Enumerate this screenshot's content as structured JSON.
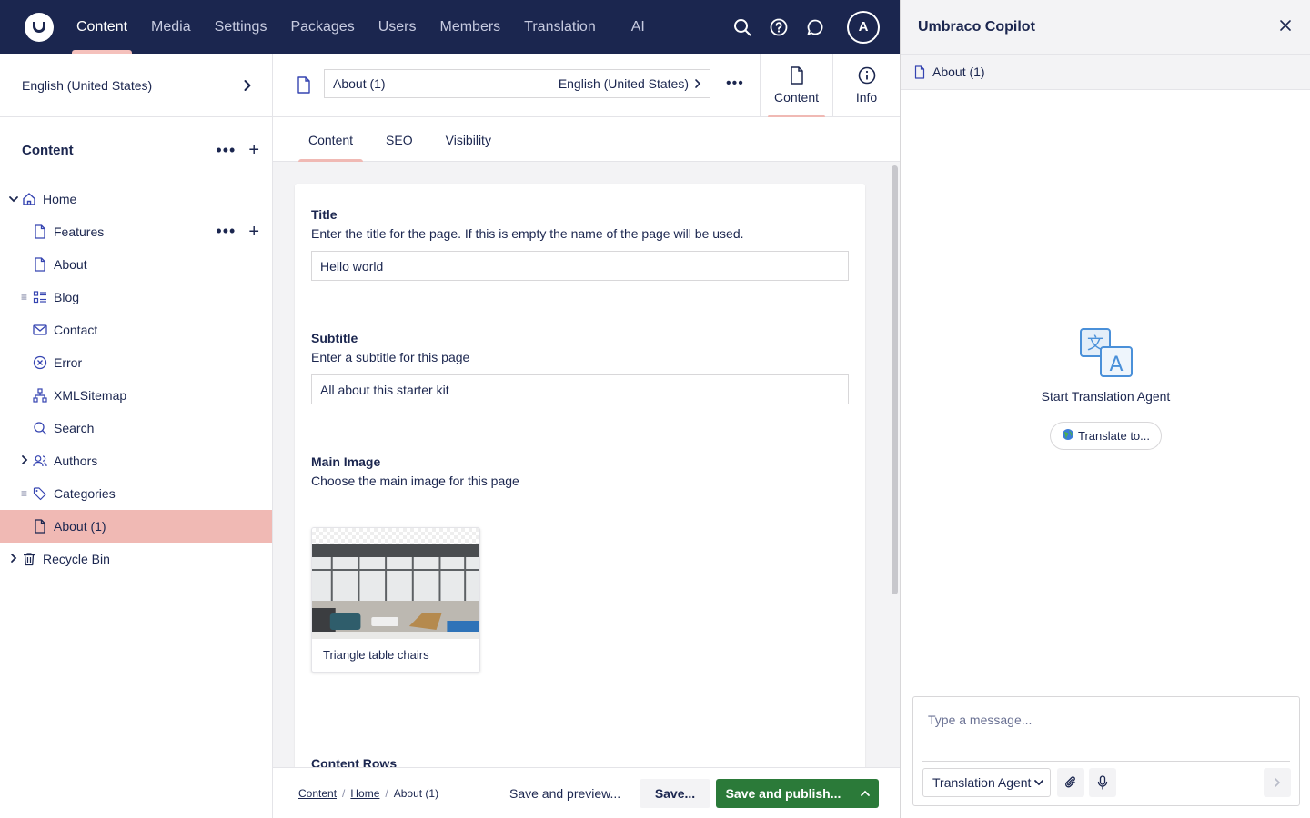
{
  "topbar": {
    "nav": [
      "Content",
      "Media",
      "Settings",
      "Packages",
      "Users",
      "Members",
      "Translation",
      "AI"
    ],
    "active": "Content",
    "avatar_initial": "A"
  },
  "sidebar": {
    "culture": "English (United States)",
    "section_title": "Content",
    "tree": [
      {
        "label": "Home",
        "icon": "home-icon",
        "level": 0,
        "caret": "expanded"
      },
      {
        "label": "Features",
        "icon": "document-icon",
        "level": 1,
        "actions": true
      },
      {
        "label": "About",
        "icon": "document-icon",
        "level": 1
      },
      {
        "label": "Blog",
        "icon": "list-icon",
        "level": 1,
        "drag": true
      },
      {
        "label": "Contact",
        "icon": "envelope-icon",
        "level": 1
      },
      {
        "label": "Error",
        "icon": "error-icon",
        "level": 1
      },
      {
        "label": "XMLSitemap",
        "icon": "sitemap-icon",
        "level": 1
      },
      {
        "label": "Search",
        "icon": "search-icon",
        "level": 1
      },
      {
        "label": "Authors",
        "icon": "users-icon",
        "level": 1,
        "caret": "collapsed"
      },
      {
        "label": "Categories",
        "icon": "tag-icon",
        "level": 1,
        "drag": true
      },
      {
        "label": "About (1)",
        "icon": "document-icon",
        "level": 1,
        "selected": true
      },
      {
        "label": "Recycle Bin",
        "icon": "trash-icon",
        "level": 0,
        "caret": "collapsed"
      }
    ]
  },
  "workspace": {
    "doc_name": "About (1)",
    "culture": "English (United States)",
    "views": {
      "content": "Content",
      "info": "Info"
    },
    "tabs": [
      "Content",
      "SEO",
      "Visibility"
    ],
    "properties": {
      "title": {
        "label": "Title",
        "desc": "Enter the title for the page. If this is empty the name of the page will be used.",
        "value": "Hello world"
      },
      "subtitle": {
        "label": "Subtitle",
        "desc": "Enter a subtitle for this page",
        "value": "All about this starter kit"
      },
      "main_image": {
        "label": "Main Image",
        "desc": "Choose the main image for this page",
        "media_name": "Triangle table chairs"
      },
      "content_rows": {
        "label": "Content Rows"
      }
    },
    "footer": {
      "breadcrumbs": [
        "Content",
        "Home",
        "About (1)"
      ],
      "preview": "Save and preview...",
      "save": "Save...",
      "publish": "Save and publish..."
    }
  },
  "copilot": {
    "title": "Umbraco Copilot",
    "context": "About (1)",
    "agent_label": "Start Translation Agent",
    "translate_button": "Translate to...",
    "input_placeholder": "Type a message...",
    "agent_select": "Translation Agent"
  },
  "colors": {
    "topbar": "#1b264f",
    "selected": "#f0b9b4",
    "publish": "#2b7a39"
  }
}
